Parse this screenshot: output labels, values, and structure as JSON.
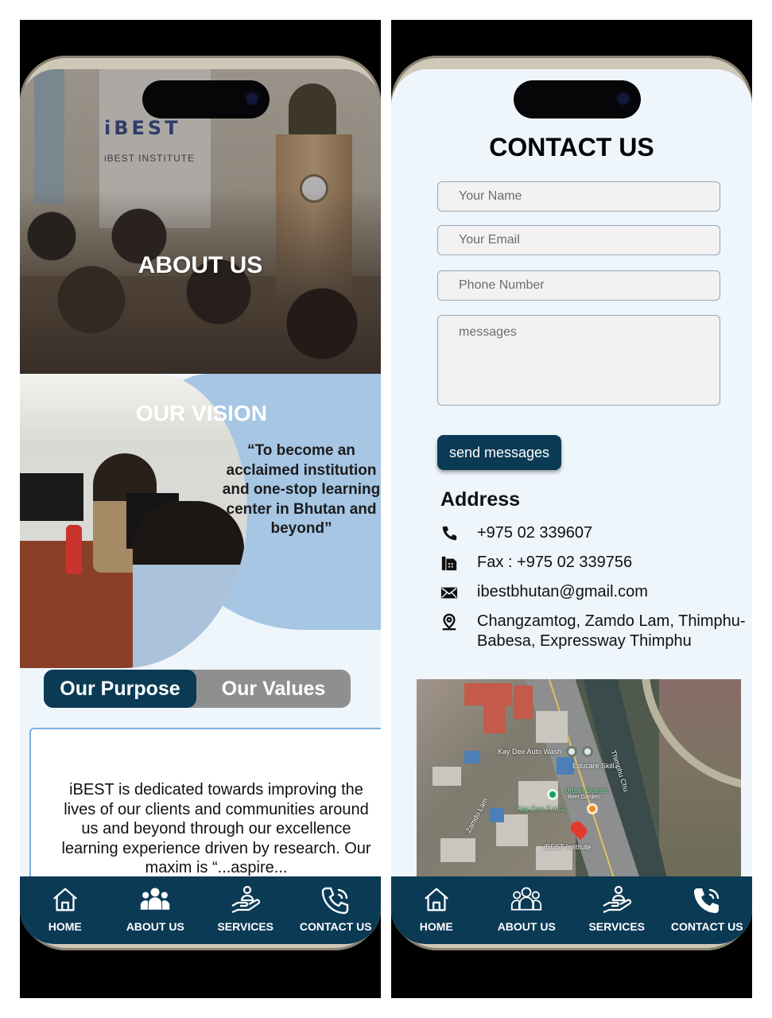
{
  "left_screen": {
    "hero": {
      "title": "ABOUT US",
      "banner_logo": "iBEST",
      "banner_sub": "iBEST INSTITUTE"
    },
    "vision": {
      "title": "OUR VISION",
      "quote": "“To become an acclaimed institution and one-stop learning center in Bhutan and beyond”"
    },
    "tabs": {
      "active": "Our Purpose",
      "inactive": "Our Values"
    },
    "purpose_text": "iBEST is dedicated towards improving the lives of our clients and communities around us and beyond through our excellence learning experience driven by research. Our maxim is “...aspire..."
  },
  "right_screen": {
    "title": "CONTACT US",
    "form": {
      "name_placeholder": "Your Name",
      "email_placeholder": "Your Email",
      "phone_placeholder": "Phone Number",
      "message_placeholder": "messages",
      "send_label": "send messages"
    },
    "address": {
      "title": "Address",
      "phone": "+975 02 339607",
      "fax": "Fax : +975 02 339756",
      "email": "ibestbhutan@gmail.com",
      "location": "Changzamtog, Zamdo Lam, Thimphu-Babesa, Expressway Thimphu"
    },
    "map": {
      "labels": {
        "autowash": "Kay Dee Auto Wash",
        "educare": "Educare Skill",
        "chu": "Thimphu Chu",
        "dumra": "Urban Dumra",
        "beer": "Beer Garden",
        "futsal": "Kay Dee Futsal",
        "lam": "Zamdo Lam",
        "institute": "iBEST Institute"
      }
    }
  },
  "navbar": {
    "items": [
      {
        "label": "HOME",
        "icon": "home-icon"
      },
      {
        "label": "ABOUT US",
        "icon": "people-icon"
      },
      {
        "label": "SERVICES",
        "icon": "service-hand-icon"
      },
      {
        "label": "CONTACT US",
        "icon": "phone-call-icon"
      }
    ]
  },
  "colors": {
    "primary": "#0b3a55",
    "vision_blob": "#a6c6e4",
    "page_bg": "#eef5fb"
  }
}
